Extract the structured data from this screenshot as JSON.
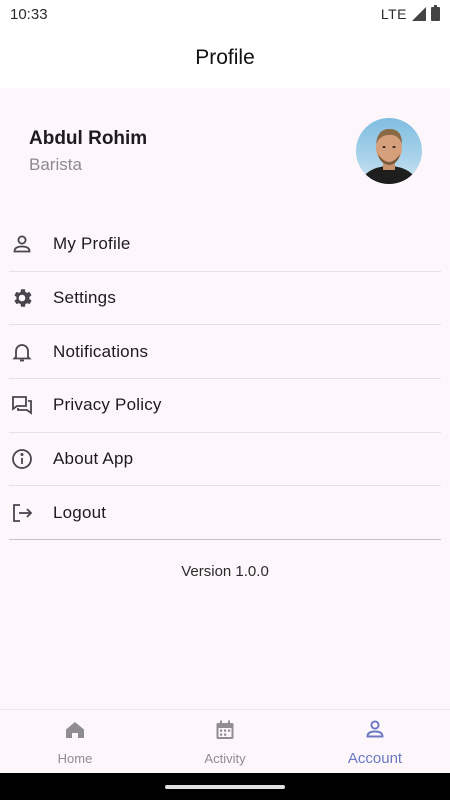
{
  "status_bar": {
    "time": "10:33",
    "network": "LTE"
  },
  "app_bar": {
    "title": "Profile"
  },
  "user": {
    "name": "Abdul Rohim",
    "role": "Barista"
  },
  "menu": {
    "items": [
      {
        "label": "My Profile",
        "icon": "person-icon"
      },
      {
        "label": "Settings",
        "icon": "gear-icon"
      },
      {
        "label": "Notifications",
        "icon": "bell-icon"
      },
      {
        "label": "Privacy Policy",
        "icon": "forum-icon"
      },
      {
        "label": "About App",
        "icon": "info-icon"
      },
      {
        "label": "Logout",
        "icon": "logout-icon"
      }
    ]
  },
  "version": "Version 1.0.0",
  "bottom_nav": {
    "items": [
      {
        "label": "Home",
        "icon": "home-icon",
        "active": false
      },
      {
        "label": "Activity",
        "icon": "calendar-icon",
        "active": false
      },
      {
        "label": "Account",
        "icon": "person-icon",
        "active": true
      }
    ]
  },
  "colors": {
    "accent": "#6a79c2",
    "background": "#fdf7fc",
    "icon": "#49454f",
    "muted": "#8f8c92"
  }
}
